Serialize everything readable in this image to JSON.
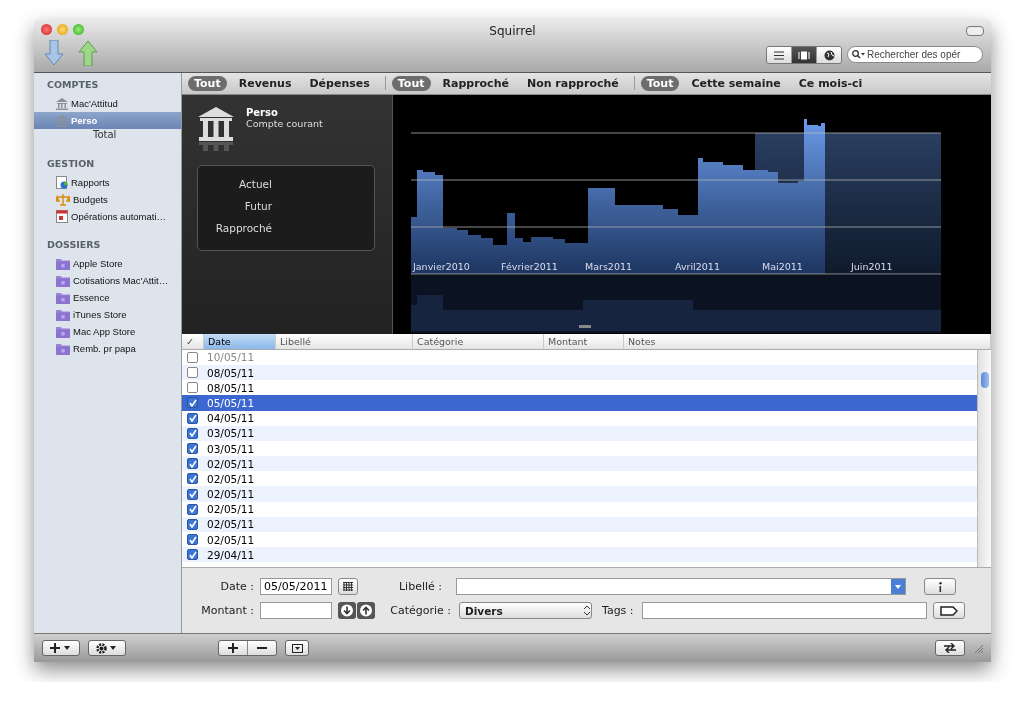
{
  "window": {
    "title": "Squirrel"
  },
  "view_modes": [
    {
      "kind": "list",
      "selected": false
    },
    {
      "kind": "cover",
      "selected": true
    },
    {
      "kind": "globe",
      "selected": false
    }
  ],
  "search": {
    "placeholder": "Rechercher des opér"
  },
  "sidebar": {
    "sections": [
      {
        "title": "COMPTES",
        "items": [
          {
            "label": "Mac'Attitud",
            "kind": "account",
            "selected": false
          },
          {
            "label": "Perso",
            "kind": "account",
            "selected": true
          }
        ],
        "total": "Total"
      },
      {
        "title": "GESTION",
        "items": [
          {
            "label": "Rapports",
            "kind": "report",
            "selected": false
          },
          {
            "label": "Budgets",
            "kind": "budget",
            "selected": false
          },
          {
            "label": "Opérations automati…",
            "kind": "schedule",
            "selected": false
          }
        ]
      },
      {
        "title": "DOSSIERS",
        "items": [
          {
            "label": "Apple Store",
            "kind": "folder",
            "selected": false
          },
          {
            "label": "Cotisations Mac'Attit…",
            "kind": "folder",
            "selected": false
          },
          {
            "label": "Essence",
            "kind": "folder",
            "selected": false
          },
          {
            "label": "iTunes Store",
            "kind": "folder",
            "selected": false
          },
          {
            "label": "Mac App Store",
            "kind": "folder",
            "selected": false
          },
          {
            "label": "Remb. pr papa",
            "kind": "folder",
            "selected": false
          }
        ]
      }
    ]
  },
  "filters": [
    {
      "options": [
        {
          "label": "Tout",
          "selected": true
        },
        {
          "label": "Revenus",
          "selected": false
        },
        {
          "label": "Dépenses",
          "selected": false
        }
      ]
    },
    {
      "options": [
        {
          "label": "Tout",
          "selected": true
        },
        {
          "label": "Rapproché",
          "selected": false
        },
        {
          "label": "Non rapproché",
          "selected": false
        }
      ]
    },
    {
      "options": [
        {
          "label": "Tout",
          "selected": true
        },
        {
          "label": "Cette semaine",
          "selected": false
        },
        {
          "label": "Ce mois-ci",
          "selected": false
        }
      ]
    }
  ],
  "overview": {
    "account_name": "Perso",
    "account_type": "Compte courant",
    "balances": [
      {
        "label": "Actuel"
      },
      {
        "label": "Futur"
      },
      {
        "label": "Rapproché"
      }
    ]
  },
  "balance_chart": {
    "month_labels": [
      "Janvier2010",
      "Février2011",
      "Mars2011",
      "Avril2011",
      "Mai2011",
      "Juin2011"
    ]
  },
  "table": {
    "columns": [
      {
        "label": "✓",
        "sorted": false
      },
      {
        "label": "Date",
        "sorted": true
      },
      {
        "label": "Libellé",
        "sorted": false
      },
      {
        "label": "Catégorie",
        "sorted": false
      },
      {
        "label": "Montant",
        "sorted": false
      },
      {
        "label": "Notes",
        "sorted": false
      }
    ],
    "rows": [
      {
        "date": "10/05/11",
        "checked": false,
        "selected": false,
        "dimmed": true
      },
      {
        "date": "08/05/11",
        "checked": false,
        "selected": false,
        "dimmed": false
      },
      {
        "date": "08/05/11",
        "checked": false,
        "selected": false,
        "dimmed": false
      },
      {
        "date": "05/05/11",
        "checked": true,
        "selected": true,
        "dimmed": false
      },
      {
        "date": "04/05/11",
        "checked": true,
        "selected": false,
        "dimmed": false
      },
      {
        "date": "03/05/11",
        "checked": true,
        "selected": false,
        "dimmed": false
      },
      {
        "date": "03/05/11",
        "checked": true,
        "selected": false,
        "dimmed": false
      },
      {
        "date": "02/05/11",
        "checked": true,
        "selected": false,
        "dimmed": false
      },
      {
        "date": "02/05/11",
        "checked": true,
        "selected": false,
        "dimmed": false
      },
      {
        "date": "02/05/11",
        "checked": true,
        "selected": false,
        "dimmed": false
      },
      {
        "date": "02/05/11",
        "checked": true,
        "selected": false,
        "dimmed": false
      },
      {
        "date": "02/05/11",
        "checked": true,
        "selected": false,
        "dimmed": false
      },
      {
        "date": "02/05/11",
        "checked": true,
        "selected": false,
        "dimmed": false
      },
      {
        "date": "29/04/11",
        "checked": true,
        "selected": false,
        "dimmed": false
      }
    ]
  },
  "form": {
    "date_label": "Date :",
    "date_value": "05/05/2011",
    "amount_label": "Montant :",
    "libelle_label": "Libellé :",
    "category_label": "Catégorie :",
    "category_value": "Divers",
    "tags_label": "Tags :"
  }
}
